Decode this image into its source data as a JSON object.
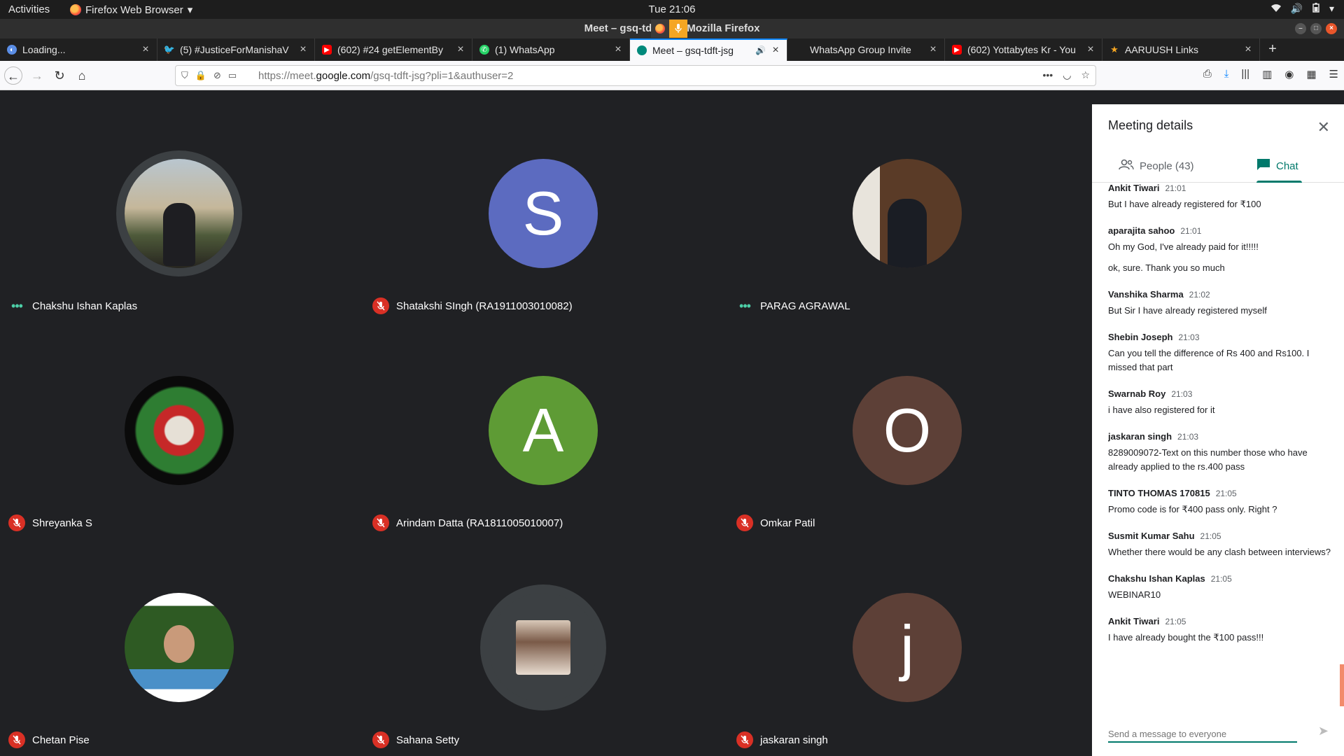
{
  "system": {
    "activities": "Activities",
    "app_name": "Firefox Web Browser",
    "clock": "Tue 21:06"
  },
  "window": {
    "title": "Meet – gsq-tdft-jsg - Mozilla Firefox"
  },
  "tabs": [
    {
      "label": "Loading...",
      "color": "#5b8ee6"
    },
    {
      "label": "(5) #JusticeForManishaV",
      "color": "#1da1f2"
    },
    {
      "label": "(602) #24 getElementBy",
      "color": "#ff0000"
    },
    {
      "label": "(1) WhatsApp",
      "color": "#25d366"
    },
    {
      "label": "Meet – gsq-tdft-jsg",
      "color": "#00897b"
    },
    {
      "label": "WhatsApp Group Invite",
      "color": "#202020"
    },
    {
      "label": "(602) Yottabytes Kr - You",
      "color": "#ff0000"
    },
    {
      "label": "AARUUSH Links",
      "color": "#f5a623"
    }
  ],
  "address_bar": {
    "url_prefix": "https://meet.",
    "url_domain": "google.com",
    "url_suffix": "/gsq-tdft-jsg?pli=1&authuser=2"
  },
  "participants": [
    {
      "name": "Chakshu Ishan Kaplas",
      "status": "speaking",
      "initial": "",
      "bg": "#6b7b82"
    },
    {
      "name": "Shatakshi SIngh (RA1911003010082)",
      "status": "muted",
      "initial": "S",
      "bg": "#5c6bc0"
    },
    {
      "name": "PARAG AGRAWAL",
      "status": "speaking",
      "initial": "",
      "bg": "#5a4a3e"
    },
    {
      "name": "Shreyanka S",
      "status": "muted",
      "initial": "",
      "bg": "#111111"
    },
    {
      "name": "Arindam Datta (RA1811005010007)",
      "status": "muted",
      "initial": "A",
      "bg": "#5e9b35"
    },
    {
      "name": "Omkar Patil",
      "status": "muted",
      "initial": "O",
      "bg": "#5d4037"
    },
    {
      "name": "Chetan Pise",
      "status": "muted",
      "initial": "",
      "bg": "#2e5a23"
    },
    {
      "name": "Sahana Setty",
      "status": "muted",
      "initial": "",
      "bg": "#3c4043"
    },
    {
      "name": "jaskaran singh",
      "status": "muted",
      "initial": "j",
      "bg": "#5d4037"
    }
  ],
  "panel": {
    "title": "Meeting details",
    "people_tab": "People (43)",
    "chat_tab": "Chat",
    "composer_placeholder": "Send a message to everyone"
  },
  "messages": [
    {
      "sender": "Ankit Tiwari",
      "time": "21:01",
      "lines": [
        "But I have already registered for ₹100"
      ]
    },
    {
      "sender": "aparajita sahoo",
      "time": "21:01",
      "lines": [
        "Oh my God, I've already paid for it!!!!!",
        "ok, sure. Thank you so much"
      ]
    },
    {
      "sender": "Vanshika Sharma",
      "time": "21:02",
      "lines": [
        "But Sir I have already registered myself"
      ]
    },
    {
      "sender": "Shebin Joseph",
      "time": "21:03",
      "lines": [
        "Can you tell the difference of Rs 400 and Rs100. I missed that part"
      ]
    },
    {
      "sender": "Swarnab Roy",
      "time": "21:03",
      "lines": [
        "i have also registered for it"
      ]
    },
    {
      "sender": "jaskaran singh",
      "time": "21:03",
      "lines": [
        "8289009072-Text on this number those  who have already applied to the rs.400 pass"
      ]
    },
    {
      "sender": "TINTO THOMAS 170815",
      "time": "21:05",
      "lines": [
        "Promo code is for ₹400 pass only. Right ?"
      ]
    },
    {
      "sender": "Susmit Kumar Sahu",
      "time": "21:05",
      "lines": [
        "Whether there would be any clash between interviews?"
      ]
    },
    {
      "sender": "Chakshu Ishan Kaplas",
      "time": "21:05",
      "lines": [
        "WEBINAR10"
      ]
    },
    {
      "sender": "Ankit Tiwari",
      "time": "21:05",
      "lines": [
        "I have already bought the ₹100 pass!!!"
      ]
    }
  ]
}
